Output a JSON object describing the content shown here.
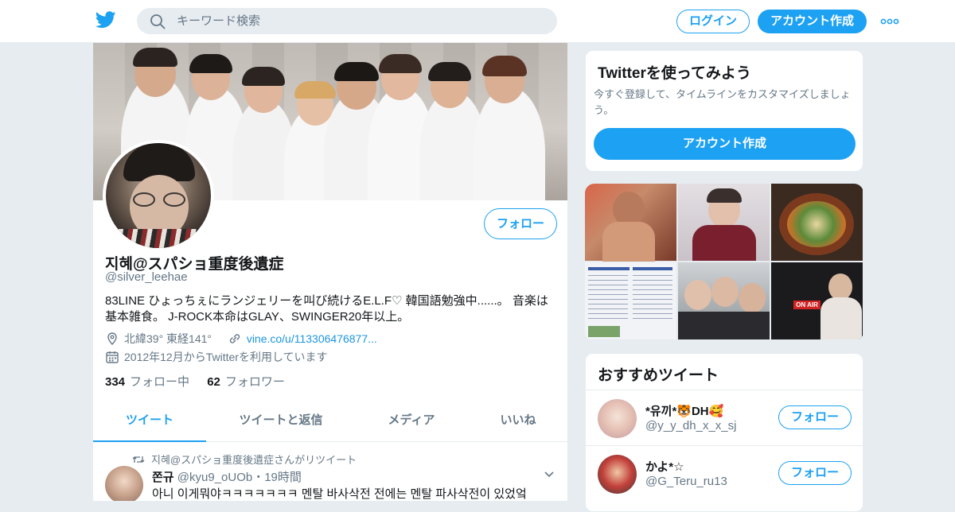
{
  "header": {
    "search_placeholder": "キーワード検索",
    "login_label": "ログイン",
    "signup_label": "アカウント作成",
    "brand_color": "#1da1f2"
  },
  "profile": {
    "display_name": "지혜@スパショ重度後遺症",
    "handle": "@silver_leehae",
    "follow_label": "フォロー",
    "bio": "83LINE ひょっちぇにランジェリーを叫び続けるE.L.F♡ 韓国語勉強中......。 音楽は基本雑食。 J-ROCK本命はGLAY、SWINGER20年以上。",
    "location": "北緯39° 東経141°",
    "url": "vine.co/u/113306476877...",
    "joined": "2012年12月からTwitterを利用しています",
    "following_count": "334",
    "following_label": "フォロー中",
    "followers_count": "62",
    "followers_label": "フォロワー"
  },
  "tabs": [
    {
      "label": "ツイート",
      "active": true
    },
    {
      "label": "ツイートと返信",
      "active": false
    },
    {
      "label": "メディア",
      "active": false
    },
    {
      "label": "いいね",
      "active": false
    }
  ],
  "tweet": {
    "retweet_notice": "지혜@スパショ重度後遺症さんがリツイート",
    "author_name": "쫀규",
    "author_handle_time": "@kyu9_oUOb・19時間",
    "text": "아니 이게뭐야ㅋㅋㅋㅋㅋㅋㅋ 멘탈 바사삭전 전에는 멘탈 파사삭전이 있었엌"
  },
  "signup_card": {
    "title": "Twitterを使ってみよう",
    "description": "今すぐ登録して、タイムラインをカスタマイズしましょう。",
    "button_label": "アカウント作成"
  },
  "media_grid": {
    "overlay_text": "ON AIR"
  },
  "recommended": {
    "title": "おすすめツイート",
    "users": [
      {
        "name": "*유끼*🐯DH🥰",
        "handle": "@y_y_dh_x_x_sj",
        "follow_label": "フォロー"
      },
      {
        "name": "かよ*☆",
        "handle": "@G_Teru_ru13",
        "follow_label": "フォロー"
      }
    ]
  }
}
